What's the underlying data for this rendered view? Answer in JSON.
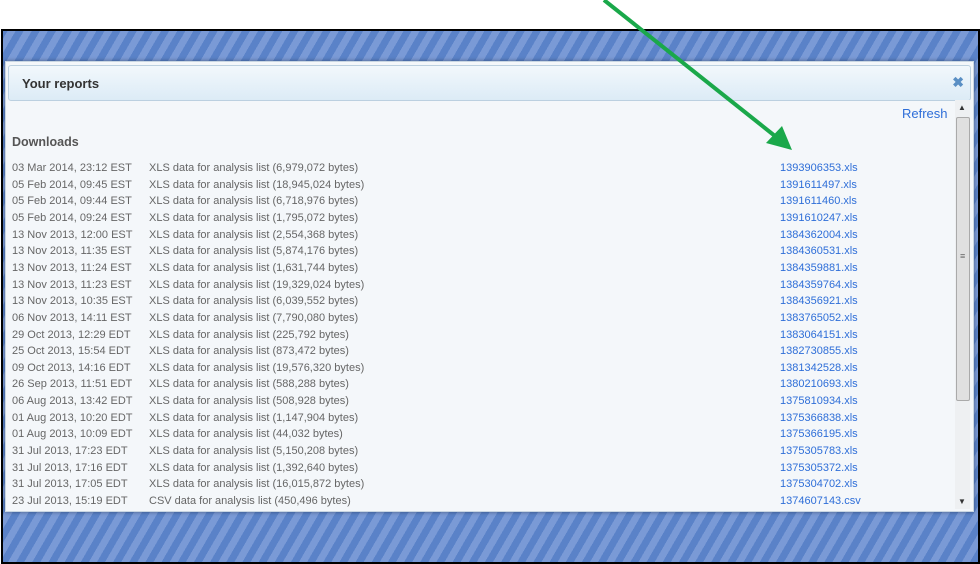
{
  "dialog": {
    "title": "Your reports",
    "close_icon": "close-icon",
    "refresh_label": "Refresh",
    "section_title": "Downloads"
  },
  "downloads": [
    {
      "date": "03 Mar 2014, 23:12 EST",
      "type": "XLS data for analysis list (6,979,072 bytes)",
      "file": "1393906353.xls"
    },
    {
      "date": "05 Feb 2014, 09:45 EST",
      "type": "XLS data for analysis list (18,945,024 bytes)",
      "file": "1391611497.xls"
    },
    {
      "date": "05 Feb 2014, 09:44 EST",
      "type": "XLS data for analysis list (6,718,976 bytes)",
      "file": "1391611460.xls"
    },
    {
      "date": "05 Feb 2014, 09:24 EST",
      "type": "XLS data for analysis list (1,795,072 bytes)",
      "file": "1391610247.xls"
    },
    {
      "date": "13 Nov 2013, 12:00 EST",
      "type": "XLS data for analysis list (2,554,368 bytes)",
      "file": "1384362004.xls"
    },
    {
      "date": "13 Nov 2013, 11:35 EST",
      "type": "XLS data for analysis list (5,874,176 bytes)",
      "file": "1384360531.xls"
    },
    {
      "date": "13 Nov 2013, 11:24 EST",
      "type": "XLS data for analysis list (1,631,744 bytes)",
      "file": "1384359881.xls"
    },
    {
      "date": "13 Nov 2013, 11:23 EST",
      "type": "XLS data for analysis list (19,329,024 bytes)",
      "file": "1384359764.xls"
    },
    {
      "date": "13 Nov 2013, 10:35 EST",
      "type": "XLS data for analysis list (6,039,552 bytes)",
      "file": "1384356921.xls"
    },
    {
      "date": "06 Nov 2013, 14:11 EST",
      "type": "XLS data for analysis list (7,790,080 bytes)",
      "file": "1383765052.xls"
    },
    {
      "date": "29 Oct 2013, 12:29 EDT",
      "type": "XLS data for analysis list (225,792 bytes)",
      "file": "1383064151.xls"
    },
    {
      "date": "25 Oct 2013, 15:54 EDT",
      "type": "XLS data for analysis list (873,472 bytes)",
      "file": "1382730855.xls"
    },
    {
      "date": "09 Oct 2013, 14:16 EDT",
      "type": "XLS data for analysis list (19,576,320 bytes)",
      "file": "1381342528.xls"
    },
    {
      "date": "26 Sep 2013, 11:51 EDT",
      "type": "XLS data for analysis list (588,288 bytes)",
      "file": "1380210693.xls"
    },
    {
      "date": "06 Aug 2013, 13:42 EDT",
      "type": "XLS data for analysis list (508,928 bytes)",
      "file": "1375810934.xls"
    },
    {
      "date": "01 Aug 2013, 10:20 EDT",
      "type": "XLS data for analysis list (1,147,904 bytes)",
      "file": "1375366838.xls"
    },
    {
      "date": "01 Aug 2013, 10:09 EDT",
      "type": "XLS data for analysis list (44,032 bytes)",
      "file": "1375366195.xls"
    },
    {
      "date": "31 Jul 2013, 17:23 EDT",
      "type": "XLS data for analysis list (5,150,208 bytes)",
      "file": "1375305783.xls"
    },
    {
      "date": "31 Jul 2013, 17:16 EDT",
      "type": "XLS data for analysis list (1,392,640 bytes)",
      "file": "1375305372.xls"
    },
    {
      "date": "31 Jul 2013, 17:05 EDT",
      "type": "XLS data for analysis list (16,015,872 bytes)",
      "file": "1375304702.xls"
    },
    {
      "date": "23 Jul 2013, 15:19 EDT",
      "type": "CSV data for analysis list (450,496 bytes)",
      "file": "1374607143.csv"
    }
  ],
  "colors": {
    "link": "#2e6ed8",
    "annotation_arrow": "#1aa84a",
    "background_stripes": "#5a82c8"
  }
}
